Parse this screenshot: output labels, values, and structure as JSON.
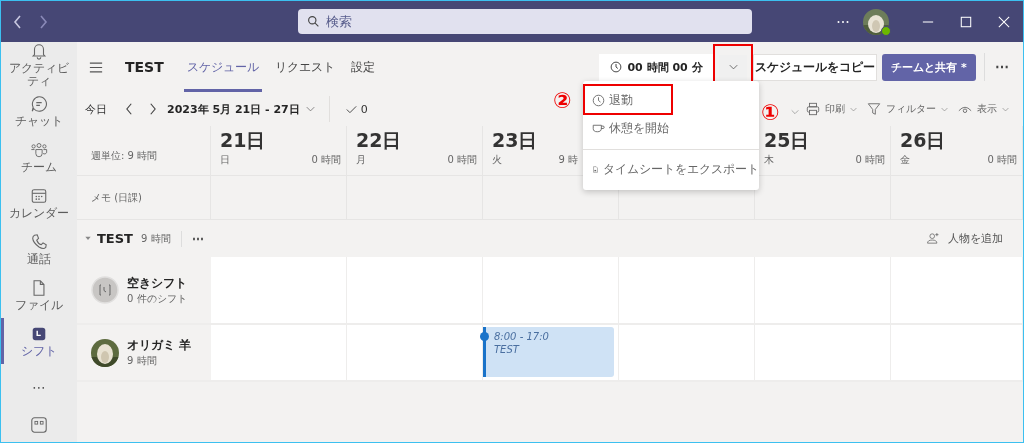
{
  "titlebar": {
    "search": {
      "placeholder": "検索"
    }
  },
  "rail": [
    {
      "label": "アクティビティ",
      "selected": false
    },
    {
      "label": "チャット",
      "selected": false
    },
    {
      "label": "チーム",
      "selected": false
    },
    {
      "label": "カレンダー",
      "selected": false
    },
    {
      "label": "通話",
      "selected": false
    },
    {
      "label": "ファイル",
      "selected": false
    },
    {
      "label": "シフト",
      "selected": true
    },
    {
      "label": "⋯",
      "selected": false
    }
  ],
  "header": {
    "team": "TEST",
    "tabs": [
      {
        "label": "スケジュール",
        "selected": true
      },
      {
        "label": "リクエスト",
        "selected": false
      },
      {
        "label": "設定",
        "selected": false
      }
    ],
    "clock_button": "00 時間 00 分",
    "copy_button": "スケジュールをコピー",
    "share_button": "チームと共有 *",
    "more": "⋯"
  },
  "menu": [
    {
      "label": "退勤"
    },
    {
      "label": "休憩を開始"
    },
    {
      "label": "タイムシートをエクスポート"
    }
  ],
  "annotations": [
    {
      "label": "①"
    },
    {
      "label": "②"
    }
  ],
  "toolbar": {
    "today": "今日",
    "range": "2023年 5月 21日 - 27日",
    "approvals": "0",
    "print": "印刷",
    "filter": "フィルター",
    "view": "表示"
  },
  "week_hours": "週単位: 9 時間",
  "memo": "メモ (日課)",
  "days": [
    {
      "date": "21日",
      "weekday": "日",
      "hours": "0 時間"
    },
    {
      "date": "22日",
      "weekday": "月",
      "hours": "0 時間"
    },
    {
      "date": "23日",
      "weekday": "火",
      "hours": "9 時"
    },
    {
      "date": "25日",
      "weekday": "木",
      "hours": "0 時間"
    },
    {
      "date": "26日",
      "weekday": "金",
      "hours": "0 時間"
    }
  ],
  "group": {
    "name": "TEST",
    "hours": "9 時間",
    "more": "⋯",
    "add_person": "人物を追加"
  },
  "members": [
    {
      "kind": "open",
      "name": "空きシフト",
      "detail": "0 件のシフト"
    },
    {
      "kind": "person",
      "name": "オリガミ 羊",
      "detail": "9 時間",
      "shift": {
        "time": "8:00 - 17:0",
        "label": "TEST"
      }
    }
  ]
}
